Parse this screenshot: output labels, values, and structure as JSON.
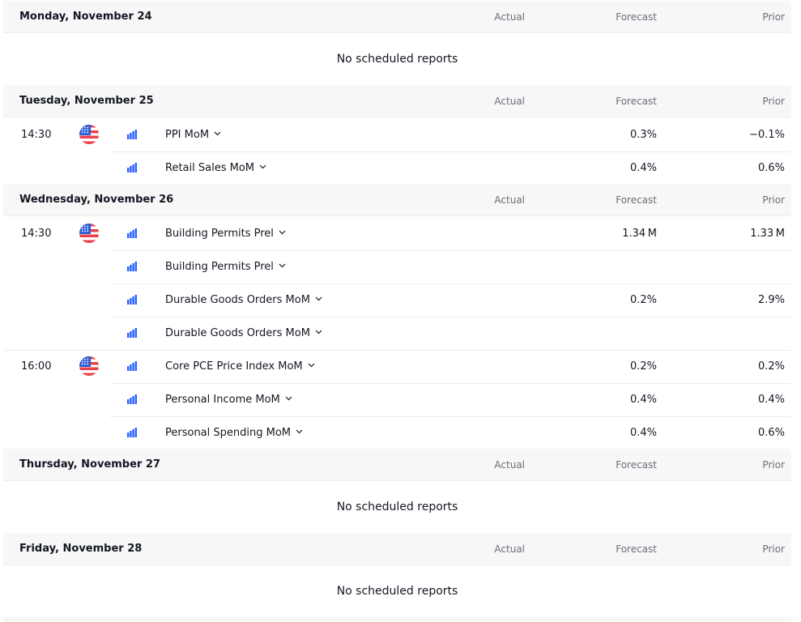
{
  "columns": {
    "actual": "Actual",
    "forecast": "Forecast",
    "prior": "Prior"
  },
  "empty_text": "No scheduled reports",
  "days": [
    {
      "title": "Monday, November 24",
      "events": []
    },
    {
      "title": "Tuesday, November 25",
      "events": [
        {
          "time": "14:30",
          "country": "us-flag",
          "name": "PPI MoM",
          "actual": "",
          "forecast": "0.3%",
          "prior": "−0.1%"
        },
        {
          "time": "",
          "country": "",
          "name": "Retail Sales MoM",
          "actual": "",
          "forecast": "0.4%",
          "prior": "0.6%"
        }
      ]
    },
    {
      "title": "Wednesday, November 26",
      "events": [
        {
          "time": "14:30",
          "country": "us-flag",
          "name": "Building Permits Prel",
          "actual": "",
          "forecast": "1.34 M",
          "prior": "1.33 M"
        },
        {
          "time": "",
          "country": "",
          "name": "Building Permits Prel",
          "actual": "",
          "forecast": "",
          "prior": ""
        },
        {
          "time": "",
          "country": "",
          "name": "Durable Goods Orders MoM",
          "actual": "",
          "forecast": "0.2%",
          "prior": "2.9%"
        },
        {
          "time": "",
          "country": "",
          "name": "Durable Goods Orders MoM",
          "actual": "",
          "forecast": "",
          "prior": ""
        },
        {
          "time": "16:00",
          "country": "us-flag",
          "name": "Core PCE Price Index MoM",
          "actual": "",
          "forecast": "0.2%",
          "prior": "0.2%"
        },
        {
          "time": "",
          "country": "",
          "name": "Personal Income MoM",
          "actual": "",
          "forecast": "0.4%",
          "prior": "0.4%"
        },
        {
          "time": "",
          "country": "",
          "name": "Personal Spending MoM",
          "actual": "",
          "forecast": "0.4%",
          "prior": "0.6%"
        }
      ]
    },
    {
      "title": "Thursday, November 27",
      "events": []
    },
    {
      "title": "Friday, November 28",
      "events": []
    }
  ],
  "icons": {
    "importance": "bar-chart-icon",
    "expand": "chevron-down-icon",
    "flag": "us-flag-icon"
  },
  "colors": {
    "importance_bars": "#2962ff",
    "header_bg": "#f7f7f8",
    "muted_text": "#6a6d78"
  }
}
